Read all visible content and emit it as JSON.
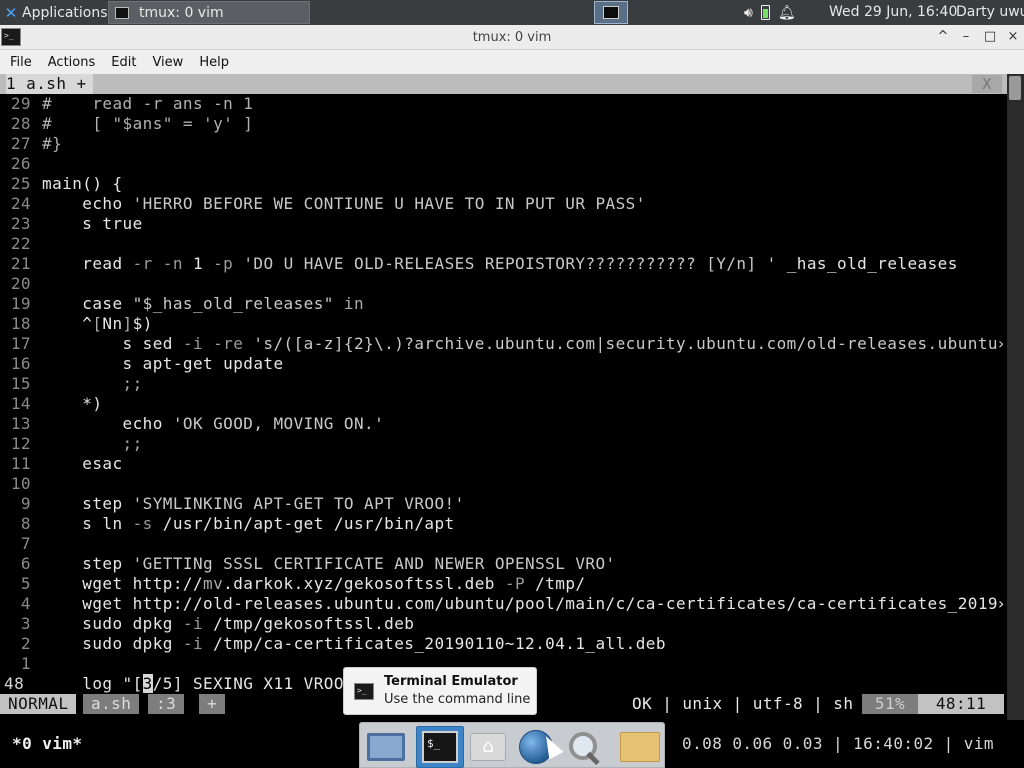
{
  "panel": {
    "apps_label": "Applications",
    "task_label": "tmux: 0 vim",
    "clock": "Wed 29 Jun, 16:40",
    "user": "Darty uwu",
    "icons": [
      "xfce-logo-icon",
      "terminal-icon",
      "volume-icon",
      "battery-icon",
      "bell-icon"
    ]
  },
  "window": {
    "title": "tmux: 0 vim",
    "buttons": [
      "^",
      "–",
      "□",
      "×"
    ]
  },
  "menubar": [
    "File",
    "Actions",
    "Edit",
    "View",
    "Help"
  ],
  "vim": {
    "tab_label": "1 a.sh +",
    "tab_close": "X",
    "lines": [
      {
        "n": "29",
        "tokens": [
          {
            "t": "#    read -r ans -n 1",
            "c": "cmt"
          }
        ]
      },
      {
        "n": "28",
        "tokens": [
          {
            "t": "#    [ \"$ans\" = 'y' ]",
            "c": "cmt"
          }
        ]
      },
      {
        "n": "27",
        "tokens": [
          {
            "t": "#}",
            "c": "cmt"
          }
        ]
      },
      {
        "n": "26",
        "tokens": []
      },
      {
        "n": "25",
        "tokens": [
          {
            "t": "main() {",
            "c": ""
          }
        ]
      },
      {
        "n": "24",
        "tokens": [
          {
            "t": "    echo ",
            "c": ""
          },
          {
            "t": "'HERRO BEFORE WE CONTIUNE U HAVE TO IN PUT UR PASS'",
            "c": "str"
          }
        ]
      },
      {
        "n": "23",
        "tokens": [
          {
            "t": "    s true",
            "c": ""
          }
        ]
      },
      {
        "n": "22",
        "tokens": []
      },
      {
        "n": "21",
        "tokens": [
          {
            "t": "    read ",
            "c": ""
          },
          {
            "t": "-r -n ",
            "c": "flag"
          },
          {
            "t": "1 ",
            "c": ""
          },
          {
            "t": "-p ",
            "c": "flag"
          },
          {
            "t": "'DO U HAVE OLD-RELEASES REPOISTORY??????????? [Y/n] '",
            "c": "str"
          },
          {
            "t": " _has_old_releases",
            "c": ""
          }
        ]
      },
      {
        "n": "20",
        "tokens": []
      },
      {
        "n": "19",
        "tokens": [
          {
            "t": "    case ",
            "c": ""
          },
          {
            "t": "\"$_has_old_releases\"",
            "c": "str"
          },
          {
            "t": " in",
            "c": "dim"
          }
        ]
      },
      {
        "n": "18",
        "tokens": [
          {
            "t": "    ^",
            "c": ""
          },
          {
            "t": "[",
            "c": "dim"
          },
          {
            "t": "Nn",
            "c": ""
          },
          {
            "t": "]",
            "c": "dim"
          },
          {
            "t": "$)",
            "c": ""
          }
        ]
      },
      {
        "n": "17",
        "tokens": [
          {
            "t": "        s sed ",
            "c": ""
          },
          {
            "t": "-i -re ",
            "c": "flag"
          },
          {
            "t": "'s/([a-z]{2}\\.)?archive.ubuntu.com|security.ubuntu.com/old-releases.ubuntu»",
            "c": "str"
          }
        ]
      },
      {
        "n": "16",
        "tokens": [
          {
            "t": "        s apt-get update",
            "c": ""
          }
        ]
      },
      {
        "n": "15",
        "tokens": [
          {
            "t": "        ;;",
            "c": "dim"
          }
        ]
      },
      {
        "n": "14",
        "tokens": [
          {
            "t": "    *)",
            "c": ""
          }
        ]
      },
      {
        "n": "13",
        "tokens": [
          {
            "t": "        echo ",
            "c": ""
          },
          {
            "t": "'OK GOOD, MOVING ON.'",
            "c": "str"
          }
        ]
      },
      {
        "n": "12",
        "tokens": [
          {
            "t": "        ;;",
            "c": "dim"
          }
        ]
      },
      {
        "n": "11",
        "tokens": [
          {
            "t": "    esac",
            "c": ""
          }
        ]
      },
      {
        "n": "10",
        "tokens": []
      },
      {
        "n": "9",
        "tokens": [
          {
            "t": "    step ",
            "c": ""
          },
          {
            "t": "'SYMLINKING APT-GET TO APT VROO!'",
            "c": "str"
          }
        ]
      },
      {
        "n": "8",
        "tokens": [
          {
            "t": "    s ln ",
            "c": ""
          },
          {
            "t": "-s ",
            "c": "flag"
          },
          {
            "t": "/usr/bin/apt-get /usr/bin/apt",
            "c": ""
          }
        ]
      },
      {
        "n": "7",
        "tokens": []
      },
      {
        "n": "6",
        "tokens": [
          {
            "t": "    step ",
            "c": ""
          },
          {
            "t": "'GETTINg SSSL CERTIFICATE AND NEWER OPENSSL VRO'",
            "c": "str"
          }
        ]
      },
      {
        "n": "5",
        "tokens": [
          {
            "t": "    wget http://",
            "c": ""
          },
          {
            "t": "mv",
            "c": "dim"
          },
          {
            "t": ".darkok.xyz/gekosoftssl.deb ",
            "c": ""
          },
          {
            "t": "-P ",
            "c": "flag"
          },
          {
            "t": "/tmp/",
            "c": ""
          }
        ]
      },
      {
        "n": "4",
        "tokens": [
          {
            "t": "    wget http://old-releases.ubuntu.com/ubuntu/pool/main/c/ca-certificates/ca-certificates_2019»",
            "c": ""
          }
        ]
      },
      {
        "n": "3",
        "tokens": [
          {
            "t": "    sudo dpkg ",
            "c": ""
          },
          {
            "t": "-i ",
            "c": "flag"
          },
          {
            "t": "/tmp/gekosoftssl.deb",
            "c": ""
          }
        ]
      },
      {
        "n": "2",
        "tokens": [
          {
            "t": "    sudo dpkg ",
            "c": ""
          },
          {
            "t": "-i ",
            "c": "flag"
          },
          {
            "t": "/tmp/ca-certificates_20190110~12.04.1_all.deb",
            "c": ""
          }
        ]
      },
      {
        "n": "1",
        "tokens": []
      },
      {
        "n": "48",
        "current": true,
        "tokens": [
          {
            "t": "    log \"",
            "c": ""
          },
          {
            "t": "[",
            "c": ""
          },
          {
            "t": "3",
            "c": "cursor"
          },
          {
            "t": "/5] SEXING X11 VROO",
            "c": ""
          }
        ]
      }
    ],
    "status": {
      "mode": "NORMAL",
      "file": "a.sh",
      "tab": ":3",
      "plus": "+",
      "info": "OK | unix | utf-8 | sh",
      "percent": "51%",
      "position": "48:11"
    }
  },
  "tmux": {
    "window": "*0 vim*",
    "right": "0.08 0.06 0.03 | 16:40:02 | vim"
  },
  "tooltip": {
    "title": "Terminal Emulator",
    "subtitle": "Use the command line"
  },
  "dock": [
    "desktop-icon",
    "terminal-icon",
    "home-folder-icon",
    "web-browser-icon",
    "app-finder-icon",
    "folder-icon"
  ]
}
